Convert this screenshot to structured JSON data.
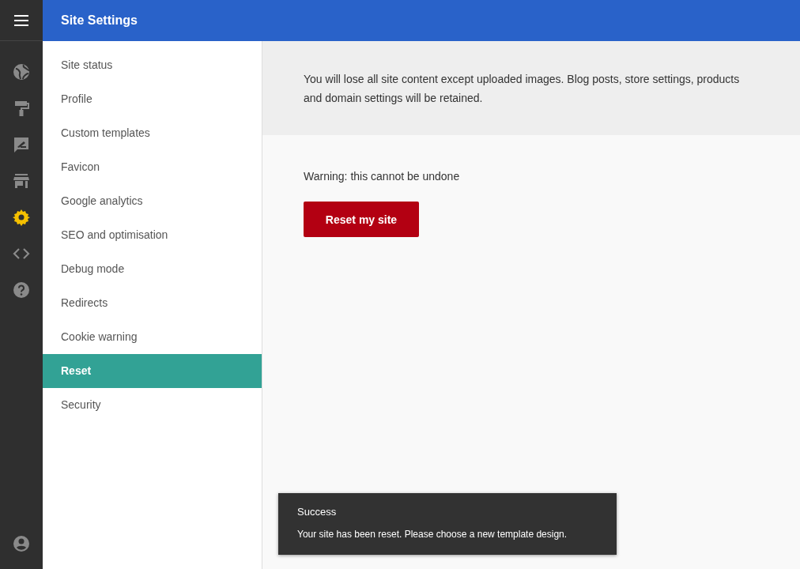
{
  "header": {
    "title": "Site Settings"
  },
  "rail": {
    "items": [
      {
        "kind": "globe",
        "selected": false
      },
      {
        "kind": "roller",
        "selected": false
      },
      {
        "kind": "comment",
        "selected": false
      },
      {
        "kind": "store",
        "selected": false
      },
      {
        "kind": "gear",
        "selected": true
      },
      {
        "kind": "code",
        "selected": false
      },
      {
        "kind": "help",
        "selected": false
      }
    ]
  },
  "nav": {
    "items": [
      {
        "label": "Site status",
        "selected": false
      },
      {
        "label": "Profile",
        "selected": false
      },
      {
        "label": "Custom templates",
        "selected": false
      },
      {
        "label": "Favicon",
        "selected": false
      },
      {
        "label": "Google analytics",
        "selected": false
      },
      {
        "label": "SEO and optimisation",
        "selected": false
      },
      {
        "label": "Debug mode",
        "selected": false
      },
      {
        "label": "Redirects",
        "selected": false
      },
      {
        "label": "Cookie warning",
        "selected": false
      },
      {
        "label": "Reset",
        "selected": true
      },
      {
        "label": "Security",
        "selected": false
      }
    ]
  },
  "content": {
    "info": "You will lose all site content except uploaded images. Blog posts, store settings, products and domain settings will be retained.",
    "warning": "Warning: this cannot be undone",
    "button": "Reset my site"
  },
  "toast": {
    "title": "Success",
    "message": "Your site has been reset. Please choose a new template design."
  }
}
